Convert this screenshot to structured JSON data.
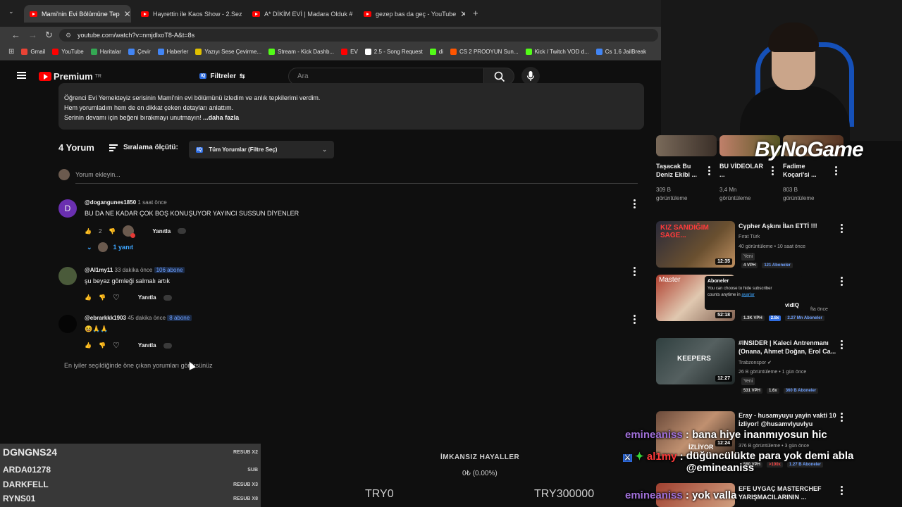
{
  "browser": {
    "tabs": [
      {
        "label": "Mami'nin Evi Bölümüne Tep",
        "active": true
      },
      {
        "label": "Hayrettin ile Kaos Show - 2.Sez",
        "active": false
      },
      {
        "label": "A* DİKİM EVİ | Madara Olduk #",
        "active": false
      },
      {
        "label": "gezep bas da geç - YouTube",
        "active": false
      }
    ],
    "new_tab": "+",
    "close": "✕",
    "url": "youtube.com/watch?v=nmjdlxoT8-A&t=8s",
    "bookmarks": [
      {
        "label": "Gmail",
        "color": "#ea4335"
      },
      {
        "label": "YouTube",
        "color": "#ff0000"
      },
      {
        "label": "Haritalar",
        "color": "#34a853"
      },
      {
        "label": "Çevir",
        "color": "#4285f4"
      },
      {
        "label": "Haberler",
        "color": "#4285f4"
      },
      {
        "label": "Yazıyı Sese Çevirme...",
        "color": "#e0c000"
      },
      {
        "label": "Stream - Kick Dashb...",
        "color": "#53fc18"
      },
      {
        "label": "EV",
        "color": "#ff0000"
      },
      {
        "label": "2.5 - Song Request",
        "color": "#ffffff"
      },
      {
        "label": "di",
        "color": "#53fc18"
      },
      {
        "label": "CS 2 PROOYUN Sun...",
        "color": "#ff5500"
      },
      {
        "label": "Kick / Twitch VOD d...",
        "color": "#53fc18"
      },
      {
        "label": "Cs 1.6 JailBreak",
        "color": "#4285f4"
      }
    ]
  },
  "yt_header": {
    "logo": "Premium",
    "logo_sup": "TR",
    "filters_label": "Filtreler",
    "iq": "IQ",
    "search_placeholder": "Ara"
  },
  "description": {
    "lines": [
      "Öğrenci Evi Yemekteyiz serisinin Mami'nin evi bölümünü izledim ve anlık tepkilerimi verdim.",
      "Hem yorumladım hem de en dikkat çeken detayları anlattım.",
      "Serinin devamı için beğeni bırakmayı unutmayın!"
    ],
    "more": "...daha fazla"
  },
  "comments_section": {
    "count_label": "4 Yorum",
    "sort_label": "Sıralama ölçütü:",
    "filter_label": "Tüm Yorumlar (Filtre Seç)",
    "add_placeholder": "Yorum ekleyin...",
    "footnote": "En iyiler seçildiğinde öne çıkan yorumları görürsünüz"
  },
  "comments": [
    {
      "user": "@dogangunes1850",
      "time": "1 saat önce",
      "subs": "",
      "text": "BU DA NE KADAR ÇOK BOŞ KONUŞUYOR YAYINCI SUSSUN DİYENLER",
      "likes": "2",
      "reply_label": "Yanıtla",
      "replies": "1 yanıt",
      "avatar_letter": "D",
      "avatar_color": "#6a2fb0"
    },
    {
      "user": "@Al1my11",
      "time": "33 dakika önce",
      "subs": "106 abone",
      "text": "şu beyaz gömleği salmalı artık",
      "likes": "",
      "reply_label": "Yanıtla",
      "avatar_color": "#4a5a3a"
    },
    {
      "user": "@ebrarkkk1903",
      "time": "45 dakika önce",
      "subs": "8 abone",
      "text": "😆🙏🙏",
      "likes": "",
      "reply_label": "Yanıtla",
      "avatar_color": "#0a0a0a"
    }
  ],
  "overlay": {
    "subs": [
      {
        "name": "DGNGNS24",
        "tag": "RESUB X2"
      },
      {
        "name": "ARDA01278",
        "tag": "SUB"
      },
      {
        "name": "DARKFELL",
        "tag": "RESUB X3"
      },
      {
        "name": "RYNS01",
        "tag": "RESUB X8"
      }
    ],
    "goal_title": "İMKANSIZ HAYALLER",
    "goal_pct": "0₺ (0.00%)",
    "goal_min": "TRY0",
    "goal_max": "TRY300000",
    "brand": "ByNoGame"
  },
  "sidebar": {
    "top_videos": [
      {
        "title": "Taşacak Bu Deniz Ekibi ...",
        "views": "309 B",
        "views2": "görüntüleme"
      },
      {
        "title": "BU VİDEOLAR ...",
        "views": "3,4 Mn",
        "views2": "görüntüleme"
      },
      {
        "title": "Fadime Koçari'si ...",
        "views": "803 B",
        "views2": "görüntüleme"
      }
    ],
    "videos": [
      {
        "title": "Cypher Aşkını İlan ETTİ !!!",
        "channel": "Fırat Türk",
        "meta": "40 görüntüleme • 10 saat önce",
        "badge": "Yeni",
        "duration": "12:35",
        "stats": [
          "4 VPH",
          "121 Aboneler"
        ],
        "thumb_text": "KIZ SANDIĞIM SAGE..."
      },
      {
        "title": "",
        "channel": "",
        "meta": "fta önce",
        "badge": "",
        "duration": "52:18",
        "stats": [
          "1.3K VPH",
          "2.8x",
          "2.27 Mn Aboneler"
        ],
        "thumb_text": "Master"
      },
      {
        "title": "#INSIDER | Kaleci Antrenmanı (Onana, Ahmet Doğan, Erol Ca...",
        "channel": "Trabzonspor",
        "meta": "26 B görüntüleme • 1 gün önce",
        "badge": "Yeni",
        "duration": "12:27",
        "stats": [
          "531 VPH",
          "1.6x",
          "360 B Aboneler"
        ],
        "thumb_text": "KEEPERS"
      },
      {
        "title": "Eray - husamyuyu yayin vakti 10 İzliyor! @husamvlyuvlyu",
        "channel": "",
        "meta": "376 B görüntüleme • 3 gün önce",
        "badge": "",
        "duration": "12:24",
        "stats": [
          "580 VPH",
          ">100x",
          "1.27 B Aboneler"
        ],
        "thumb_text": "İZLİYOR"
      },
      {
        "title": "EFE UYGAÇ MASTERCHEF YARIŞMACILARININ ...",
        "channel": "",
        "meta": "",
        "badge": "",
        "duration": "",
        "stats": [],
        "thumb_text": ""
      }
    ],
    "popup": {
      "title": "Aboneler",
      "text": "You can choose to hide subscriber counts anytime in",
      "link": "ayarlar",
      "brand": "vidIQ"
    }
  },
  "chat": [
    {
      "name": "emineaniss",
      "message": "bana hiye inanmıyosun hic"
    },
    {
      "name": "al1my",
      "message": "düğüncülükte para yok demi abla @emineaniss"
    },
    {
      "name": "emineaniss",
      "message": "yok valla"
    }
  ],
  "colors": {
    "accent": "#ff0000",
    "vidiq": "#2f6de1",
    "chat_name_1": "#a070d8",
    "chat_name_2": "#ff3a3a"
  }
}
